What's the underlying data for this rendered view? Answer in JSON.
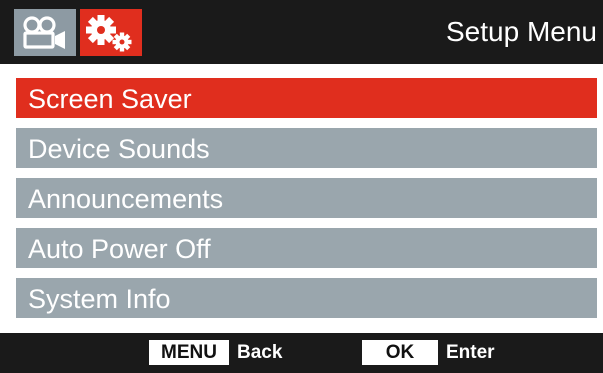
{
  "header": {
    "title": "Setup Menu",
    "tabs": [
      {
        "icon": "video-camera-icon",
        "active": false
      },
      {
        "icon": "gears-icon",
        "active": true
      }
    ]
  },
  "menu": {
    "items": [
      {
        "label": "Screen Saver",
        "selected": true
      },
      {
        "label": "Device Sounds",
        "selected": false
      },
      {
        "label": "Announcements",
        "selected": false
      },
      {
        "label": "Auto Power Off",
        "selected": false
      },
      {
        "label": "System Info",
        "selected": false
      }
    ]
  },
  "footer": {
    "menu_key": "MENU",
    "back_label": "Back",
    "ok_key": "OK",
    "enter_label": "Enter"
  },
  "colors": {
    "accent": "#e02e1e",
    "item_bg": "#9aa6ad",
    "bar_bg": "#1a1a1a"
  }
}
